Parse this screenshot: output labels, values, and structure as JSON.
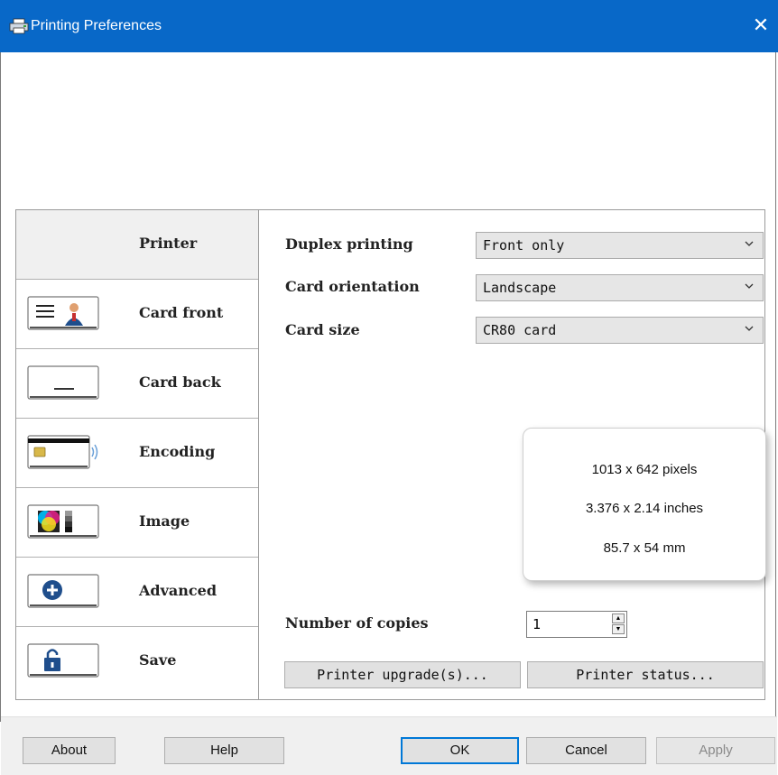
{
  "window": {
    "title": "Printing Preferences",
    "close_glyph": "✕"
  },
  "sidebar": {
    "items": [
      {
        "label": "Printer",
        "icon": "none",
        "active": true
      },
      {
        "label": "Card front",
        "icon": "card-front-icon"
      },
      {
        "label": "Card back",
        "icon": "card-back-icon"
      },
      {
        "label": "Encoding",
        "icon": "encoding-icon"
      },
      {
        "label": "Image",
        "icon": "image-color-icon"
      },
      {
        "label": "Advanced",
        "icon": "plus-circle-icon"
      },
      {
        "label": "Save",
        "icon": "lock-icon"
      }
    ]
  },
  "settings": {
    "duplex_label": "Duplex printing",
    "duplex_value": "Front only",
    "orientation_label": "Card orientation",
    "orientation_value": "Landscape",
    "size_label": "Card size",
    "size_value": "CR80 card"
  },
  "card_info": {
    "pixels": "1013 x 642 pixels",
    "inches": "3.376 x 2.14 inches",
    "mm": "85.7 x 54 mm"
  },
  "copies": {
    "label": "Number of copies",
    "value": "1"
  },
  "panel_buttons": {
    "upgrade": "Printer upgrade(s)...",
    "status": "Printer status..."
  },
  "footer": {
    "about": "About",
    "help": "Help",
    "ok": "OK",
    "cancel": "Cancel",
    "apply": "Apply"
  },
  "colors": {
    "titlebar": "#0868c8",
    "accent": "#0078d7",
    "dialog_bg": "#f0f0f0"
  }
}
